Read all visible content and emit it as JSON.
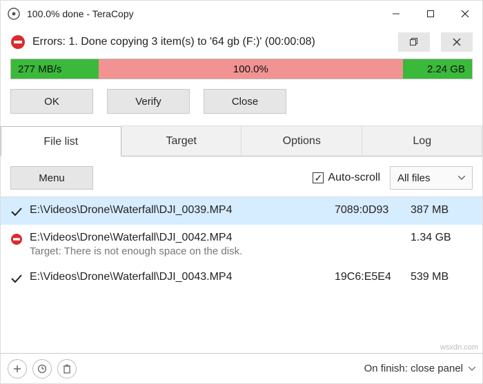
{
  "title": "100.0% done - TeraCopy",
  "status": {
    "text": "Errors: 1. Done copying 3 item(s) to '64 gb (F:)' (00:00:08)"
  },
  "progress": {
    "speed": "277 MB/s",
    "percent": "100.0%",
    "total": "2.24 GB"
  },
  "actions": {
    "ok": "OK",
    "verify": "Verify",
    "close": "Close"
  },
  "tabs": {
    "filelist": "File list",
    "target": "Target",
    "options": "Options",
    "log": "Log"
  },
  "listbar": {
    "menu": "Menu",
    "autoscroll_label": "Auto-scroll",
    "autoscroll_checked": true,
    "filter_label": "All files"
  },
  "files": [
    {
      "status": "ok",
      "path": "E:\\Videos\\Drone\\Waterfall\\DJI_0039.MP4",
      "hash": "7089:0D93",
      "size": "387 MB",
      "selected": true
    },
    {
      "status": "error",
      "path": "E:\\Videos\\Drone\\Waterfall\\DJI_0042.MP4",
      "hash": "",
      "size": "1.34 GB",
      "msg": "Target: There is not enough space on the disk."
    },
    {
      "status": "ok",
      "path": "E:\\Videos\\Drone\\Waterfall\\DJI_0043.MP4",
      "hash": "19C6:E5E4",
      "size": "539 MB"
    }
  ],
  "footer": {
    "onfinish": "On finish: close panel"
  },
  "watermark": "wsxdn.com"
}
